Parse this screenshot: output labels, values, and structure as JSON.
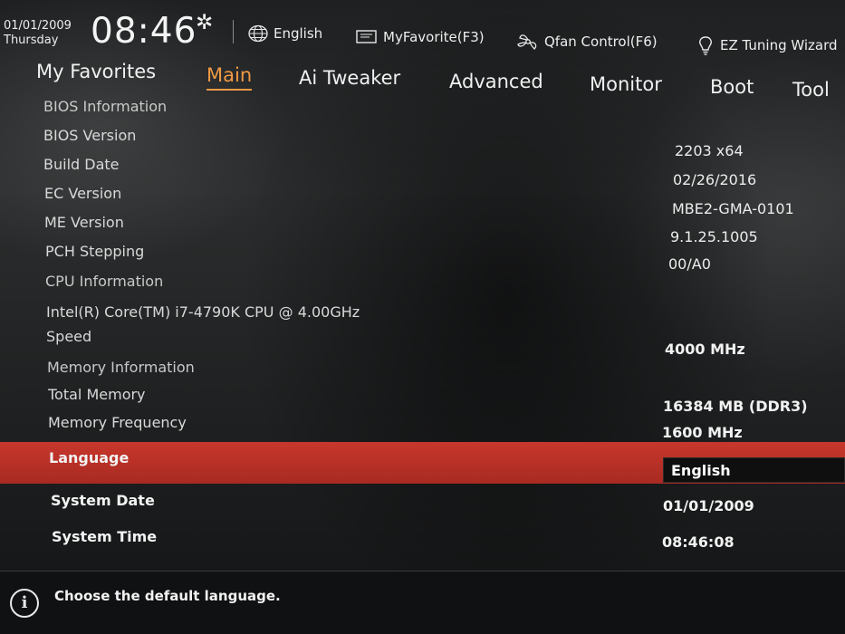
{
  "header": {
    "date": "01/01/2009",
    "weekday": "Thursday",
    "time": "08:46",
    "items": [
      {
        "label": "English",
        "icon": "globe-icon"
      },
      {
        "label": "MyFavorite(F3)",
        "icon": "monitor-icon"
      },
      {
        "label": "Qfan Control(F6)",
        "icon": "fan-icon"
      },
      {
        "label": "EZ Tuning Wizard",
        "icon": "lightbulb-icon"
      }
    ]
  },
  "tabs": [
    {
      "label": "My Favorites",
      "active": false
    },
    {
      "label": "Main",
      "active": true
    },
    {
      "label": "Ai Tweaker",
      "active": false
    },
    {
      "label": "Advanced",
      "active": false
    },
    {
      "label": "Monitor",
      "active": false
    },
    {
      "label": "Boot",
      "active": false
    },
    {
      "label": "Tool",
      "active": false
    }
  ],
  "info": {
    "bios_section": "BIOS Information",
    "bios_version_label": "BIOS Version",
    "bios_version": "2203 x64",
    "build_date_label": "Build Date",
    "build_date": "02/26/2016",
    "ec_version_label": "EC Version",
    "ec_version": "MBE2-GMA-0101",
    "me_version_label": "ME Version",
    "me_version": "9.1.25.1005",
    "pch_stepping_label": "PCH Stepping",
    "pch_stepping": "00/A0",
    "cpu_section": "CPU Information",
    "cpu_name": "Intel(R) Core(TM) i7-4790K CPU @ 4.00GHz",
    "speed_label": "Speed",
    "speed": "4000 MHz",
    "memory_section": "Memory Information",
    "total_memory_label": "Total Memory",
    "total_memory": "16384 MB (DDR3)",
    "memory_frequency_label": "Memory Frequency",
    "memory_frequency": "1600 MHz"
  },
  "settings": {
    "language_label": "Language",
    "language_value": "English",
    "system_date_label": "System Date",
    "system_date": "01/01/2009",
    "system_time_label": "System Time",
    "system_time": "08:46:08"
  },
  "help": {
    "text": "Choose the default language."
  },
  "colors": {
    "accent": "#f29a45",
    "highlight": "#c8372c",
    "background": "#161819"
  }
}
